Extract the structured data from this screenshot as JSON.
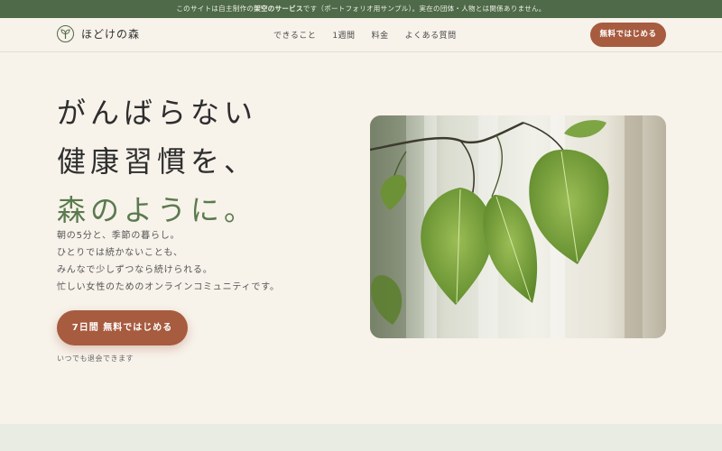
{
  "notice": {
    "prefix": "このサイトは自主制作の",
    "bold": "架空のサービス",
    "suffix": "です（ポートフォリオ用サンプル）。実在の団体・人物とは関係ありません。"
  },
  "brand": {
    "name": "ほどけの森",
    "logo_icon": "sprout-icon",
    "accent": "#4e6a48"
  },
  "nav": {
    "items": [
      "できること",
      "1週間",
      "料金",
      "よくある質問"
    ]
  },
  "header_cta": "無料ではじめる",
  "hero": {
    "title_lines": [
      "がんばらない",
      "健康習慣を、",
      "森のように。"
    ],
    "body_lines": [
      "朝の5分と、季節の暮らし。",
      "ひとりでは続かないことも、",
      "みんなで少しずつなら続けられる。",
      "忙しい女性のためのオンラインコミュニティです。"
    ],
    "cta": "7日間 無料ではじめる",
    "note": "いつでも退会できます"
  },
  "colors": {
    "cta": "#a75b3f",
    "background": "#f7f2ea",
    "title_green": "#5a7a4e"
  }
}
